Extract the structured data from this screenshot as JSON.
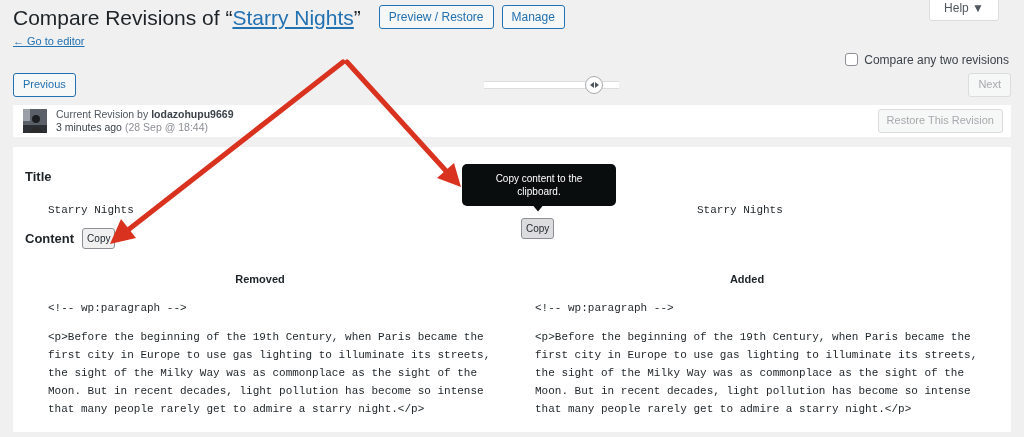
{
  "header": {
    "title_prefix": "Compare Revisions of “",
    "title_link": "Starry Nights",
    "title_suffix": "”",
    "buttons": [
      "Preview / Restore",
      "Manage"
    ],
    "help": "Help ▼",
    "back_link": "← Go to editor"
  },
  "compare_toggle": {
    "label": "Compare any two revisions",
    "checked": false
  },
  "navigation": {
    "previous": {
      "label": "Previous",
      "disabled": false
    },
    "next": {
      "label": "Next",
      "disabled": true
    },
    "slider": {
      "level": 0.87
    }
  },
  "revision": {
    "prefix": "Current Revision by ",
    "author": "lodazohupu9669",
    "time": "3 minutes ago",
    "date": "(28 Sep @ 18:44)",
    "restore": {
      "label": "Restore This Revision",
      "disabled": true
    }
  },
  "diff": {
    "title_heading": "Title",
    "title_left": "Starry Nights",
    "title_right": "Starry Nights",
    "content_heading": "Content",
    "copy_left": "Copy",
    "copy_right": "Copy",
    "tooltip": "Copy content to the clipboard.",
    "columns": [
      {
        "heading": "Removed",
        "comment": "<!-- wp:paragraph -->",
        "lines": [
          "<p>Before the beginning of the 19th Century, when Paris became the",
          "first city in Europe to use gas lighting to illuminate its streets,",
          "the sight of the Milky Way was as commonplace as the sight of the",
          "Moon. But in recent decades, light pollution has become so intense",
          "that many people rarely get to admire a starry night.</p>"
        ]
      },
      {
        "heading": "Added",
        "comment": "<!-- wp:paragraph -->",
        "lines": [
          "<p>Before the beginning of the 19th Century, when Paris became the",
          "first city in Europe to use gas lighting to illuminate its streets,",
          "the sight of the Milky Way was as commonplace as the sight of the",
          "Moon. But in recent decades, light pollution has become so intense",
          "that many people rarely get to admire a starry night.</p>"
        ]
      }
    ]
  }
}
